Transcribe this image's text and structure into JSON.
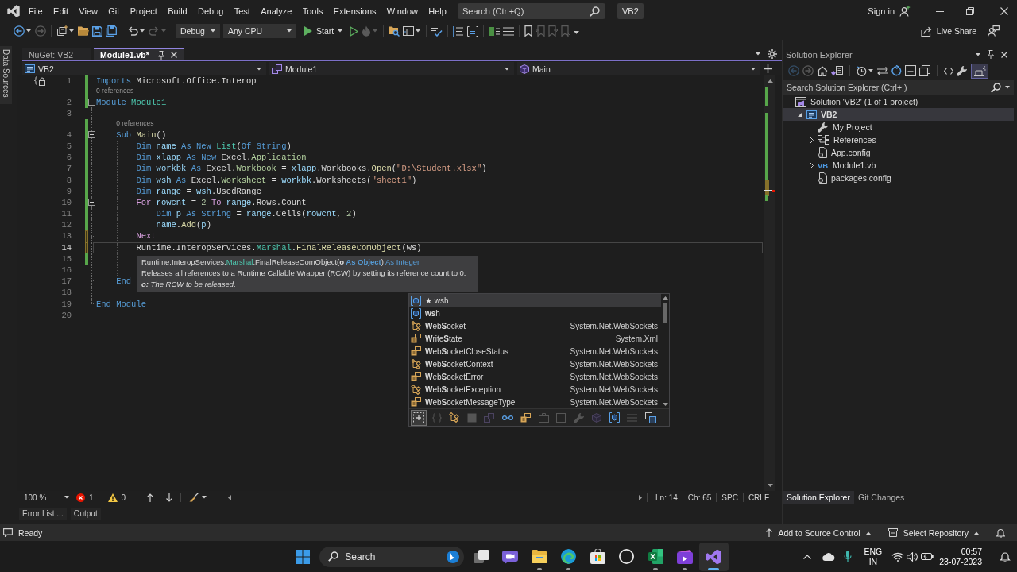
{
  "title_bar": {
    "menu": [
      "File",
      "Edit",
      "View",
      "Git",
      "Project",
      "Build",
      "Debug",
      "Test",
      "Analyze",
      "Tools",
      "Extensions",
      "Window",
      "Help"
    ],
    "search": {
      "placeholder": "Search (Ctrl+Q)"
    },
    "solution_name": "VB2",
    "sign_in": "Sign in"
  },
  "toolbar": {
    "items": [
      {
        "kind": "back",
        "disabled": false
      },
      {
        "kind": "caret",
        "disabled": false
      },
      {
        "kind": "forward",
        "disabled": true
      },
      {
        "kind": "separator"
      },
      {
        "kind": "new-item",
        "disabled": false
      },
      {
        "kind": "caret",
        "disabled": false
      },
      {
        "kind": "open",
        "disabled": false
      },
      {
        "kind": "save",
        "disabled": false
      },
      {
        "kind": "save-all",
        "disabled": false
      },
      {
        "kind": "separator"
      },
      {
        "kind": "undo",
        "disabled": false
      },
      {
        "kind": "caret",
        "disabled": false
      },
      {
        "kind": "redo",
        "disabled": true
      },
      {
        "kind": "caret",
        "disabled": true
      },
      {
        "kind": "separator"
      },
      {
        "kind": "configuration",
        "text": "Debug",
        "disabled": false
      },
      {
        "kind": "platform",
        "text": "Any CPU",
        "disabled": false
      },
      {
        "kind": "start",
        "text": "Start",
        "disabled": false
      },
      {
        "kind": "run",
        "disabled": false
      },
      {
        "kind": "hot-reload",
        "disabled": true
      },
      {
        "kind": "caret",
        "disabled": true
      },
      {
        "kind": "separator"
      },
      {
        "kind": "find-in-files",
        "disabled": false
      },
      {
        "kind": "layout",
        "disabled": false
      },
      {
        "kind": "caret",
        "disabled": false
      },
      {
        "kind": "separator"
      },
      {
        "kind": "spell-check",
        "disabled": false
      },
      {
        "kind": "separator"
      },
      {
        "kind": "step",
        "disabled": false
      },
      {
        "kind": "outline",
        "disabled": false
      },
      {
        "kind": "separator"
      },
      {
        "kind": "comment",
        "disabled": false
      },
      {
        "kind": "uncomment",
        "disabled": false
      },
      {
        "kind": "separator"
      },
      {
        "kind": "bookmark",
        "disabled": false
      },
      {
        "kind": "previous-bookmark",
        "disabled": true
      },
      {
        "kind": "next-bookmark",
        "disabled": true
      },
      {
        "kind": "clear-bookmarks",
        "disabled": true
      },
      {
        "kind": "overflow",
        "disabled": false
      }
    ],
    "live_share": "Live Share"
  },
  "side_panel": {
    "tabs": [
      "Data Sources"
    ]
  },
  "document_tabs": [
    {
      "label": "NuGet: VB2",
      "selected": false
    },
    {
      "label": "Module1.vb*",
      "selected": true
    }
  ],
  "navigation_bar": {
    "project": "VB2",
    "type": "Module1",
    "member": "Main"
  },
  "editor": {
    "lines": [
      {
        "number": "1",
        "tokens": [
          {
            "kind": "keyword",
            "text": "Imports"
          },
          {
            "kind": "plain",
            "text": " Microsoft.Office.Interop"
          }
        ],
        "changed": true,
        "saved": true,
        "quick_action": true
      },
      {
        "number": "2",
        "codelens": "0 references",
        "tokens": [
          {
            "kind": "keyword",
            "text": "Module"
          },
          {
            "kind": "type",
            "text": " Module1"
          }
        ],
        "changed": true,
        "saved": true,
        "expanded": true
      },
      {
        "number": "3"
      },
      {
        "number": "4",
        "codelens": "0 references",
        "tokens": [
          {
            "kind": "keyword",
            "text": "    Sub"
          },
          {
            "kind": "method",
            "text": " Main"
          },
          {
            "kind": "plain",
            "text": "()"
          }
        ],
        "changed": true,
        "saved": true,
        "expanded": true
      },
      {
        "number": "5",
        "tokens": [
          {
            "kind": "keyword",
            "text": "        Dim"
          },
          {
            "kind": "local",
            "text": " name"
          },
          {
            "kind": "keyword",
            "text": " As New"
          },
          {
            "kind": "type",
            "text": " List"
          },
          {
            "kind": "plain",
            "text": "("
          },
          {
            "kind": "keyword",
            "text": "Of String"
          },
          {
            "kind": "plain",
            "text": ")"
          }
        ],
        "changed": true,
        "saved": true
      },
      {
        "number": "6",
        "tokens": [
          {
            "kind": "keyword",
            "text": "        Dim"
          },
          {
            "kind": "local",
            "text": " xlapp"
          },
          {
            "kind": "keyword",
            "text": " As New"
          },
          {
            "kind": "plain",
            "text": " Excel."
          },
          {
            "kind": "interface",
            "text": "Application"
          }
        ],
        "changed": true,
        "saved": true
      },
      {
        "number": "7",
        "tokens": [
          {
            "kind": "keyword",
            "text": "        Dim"
          },
          {
            "kind": "local",
            "text": " workbk"
          },
          {
            "kind": "keyword",
            "text": " As"
          },
          {
            "kind": "plain",
            "text": " Excel."
          },
          {
            "kind": "interface",
            "text": "Workbook"
          },
          {
            "kind": "plain",
            "text": " = "
          },
          {
            "kind": "local",
            "text": "xlapp"
          },
          {
            "kind": "plain",
            "text": ".Workbooks."
          },
          {
            "kind": "method",
            "text": "Open"
          },
          {
            "kind": "plain",
            "text": "("
          },
          {
            "kind": "string",
            "text": "\"D:\\Student.xlsx\""
          },
          {
            "kind": "plain",
            "text": ")"
          }
        ],
        "changed": true,
        "saved": true
      },
      {
        "number": "8",
        "tokens": [
          {
            "kind": "keyword",
            "text": "        Dim"
          },
          {
            "kind": "local",
            "text": " wsh"
          },
          {
            "kind": "keyword",
            "text": " As"
          },
          {
            "kind": "plain",
            "text": " Excel."
          },
          {
            "kind": "interface",
            "text": "Worksheet"
          },
          {
            "kind": "plain",
            "text": " = "
          },
          {
            "kind": "local",
            "text": "workbk"
          },
          {
            "kind": "plain",
            "text": ".Worksheets("
          },
          {
            "kind": "string",
            "text": "\"sheet1\""
          },
          {
            "kind": "plain",
            "text": ")"
          }
        ],
        "changed": true,
        "saved": true
      },
      {
        "number": "9",
        "tokens": [
          {
            "kind": "keyword",
            "text": "        Dim"
          },
          {
            "kind": "local",
            "text": " range"
          },
          {
            "kind": "plain",
            "text": " = "
          },
          {
            "kind": "local",
            "text": "wsh"
          },
          {
            "kind": "plain",
            "text": ".UsedRange"
          }
        ],
        "changed": true,
        "saved": true
      },
      {
        "number": "10",
        "tokens": [
          {
            "kind": "control",
            "text": "        For"
          },
          {
            "kind": "local",
            "text": " rowcnt"
          },
          {
            "kind": "plain",
            "text": " = "
          },
          {
            "kind": "number",
            "text": "2"
          },
          {
            "kind": "control",
            "text": " To"
          },
          {
            "kind": "local",
            "text": " range"
          },
          {
            "kind": "plain",
            "text": ".Rows.Count"
          }
        ],
        "changed": true,
        "saved": true,
        "expanded": true
      },
      {
        "number": "11",
        "tokens": [
          {
            "kind": "keyword",
            "text": "            Dim"
          },
          {
            "kind": "local",
            "text": " p"
          },
          {
            "kind": "keyword",
            "text": " As String"
          },
          {
            "kind": "plain",
            "text": " = "
          },
          {
            "kind": "local",
            "text": "range"
          },
          {
            "kind": "plain",
            "text": ".Cells("
          },
          {
            "kind": "local",
            "text": "rowcnt"
          },
          {
            "kind": "plain",
            "text": ", "
          },
          {
            "kind": "number",
            "text": "2"
          },
          {
            "kind": "plain",
            "text": ")"
          }
        ],
        "changed": true,
        "saved": true
      },
      {
        "number": "12",
        "tokens": [
          {
            "kind": "local",
            "text": "            name"
          },
          {
            "kind": "plain",
            "text": "."
          },
          {
            "kind": "method",
            "text": "Add"
          },
          {
            "kind": "plain",
            "text": "("
          },
          {
            "kind": "local",
            "text": "p"
          },
          {
            "kind": "plain",
            "text": ")"
          }
        ],
        "changed": true,
        "saved": true
      },
      {
        "number": "13",
        "tokens": [
          {
            "kind": "control",
            "text": "        Next"
          }
        ],
        "changed": true,
        "saved": false
      },
      {
        "number": "14",
        "tokens": [
          {
            "kind": "plain",
            "text": "        Runtime.InteropServices."
          },
          {
            "kind": "type",
            "text": "Marshal"
          },
          {
            "kind": "plain",
            "text": "."
          },
          {
            "kind": "method",
            "text": "FinalReleaseComObject"
          },
          {
            "kind": "plain",
            "text": "(ws)"
          }
        ],
        "changed": true,
        "saved": false,
        "current": true
      },
      {
        "number": "15",
        "changed": true,
        "saved": true
      },
      {
        "number": "16"
      },
      {
        "number": "17",
        "tokens": [
          {
            "kind": "keyword",
            "text": "    End"
          }
        ]
      },
      {
        "number": "18"
      },
      {
        "number": "19",
        "tokens": [
          {
            "kind": "keyword",
            "text": "End Module"
          }
        ]
      },
      {
        "number": "20"
      }
    ],
    "quick_info": {
      "signature": [
        {
          "kind": "plain",
          "text": "Runtime.InteropServices."
        },
        {
          "kind": "type",
          "text": "Marshal"
        },
        {
          "kind": "plain",
          "text": ".FinalReleaseComObject("
        },
        {
          "kind": "param",
          "text": "o"
        },
        {
          "kind": "param_keyword",
          "text": " As Object"
        },
        {
          "kind": "plain",
          "text": ") "
        },
        {
          "kind": "keyword",
          "text": "As Integer"
        }
      ],
      "summary": "Releases all references to a Runtime Callable Wrapper (RCW) by setting its reference count to 0.",
      "parameter": "**o:** The RCW to be released."
    },
    "completion": {
      "items": [
        {
          "kind": "local",
          "label": "★ wsh",
          "selected": true
        },
        {
          "kind": "local",
          "label": "**ws**h",
          "selected": false
        },
        {
          "kind": "class",
          "label": "**W**eb**S**ocket",
          "namespace": "System.Net.WebSockets",
          "selected": false
        },
        {
          "kind": "enum",
          "label": "**W**rite**S**tate",
          "namespace": "System.Xml",
          "selected": false
        },
        {
          "kind": "enum",
          "label": "**W**eb**S**ocketCloseStatus",
          "namespace": "System.Net.WebSockets",
          "selected": false
        },
        {
          "kind": "class",
          "label": "**W**eb**S**ocketContext",
          "namespace": "System.Net.WebSockets",
          "selected": false
        },
        {
          "kind": "enum",
          "label": "**W**eb**S**ocketError",
          "namespace": "System.Net.WebSockets",
          "selected": false
        },
        {
          "kind": "class",
          "label": "**W**eb**S**ocketException",
          "namespace": "System.Net.WebSockets",
          "selected": false
        },
        {
          "kind": "enum",
          "label": "**W**eb**S**ocketMessageType",
          "namespace": "System.Net.WebSockets",
          "selected": false
        }
      ],
      "filters": [
        {
          "kind": "expander",
          "selected": true,
          "disabled": false
        },
        {
          "kind": "namespace",
          "selected": false,
          "disabled": true
        },
        {
          "kind": "class",
          "selected": false,
          "disabled": false
        },
        {
          "kind": "structure",
          "selected": false,
          "disabled": true
        },
        {
          "kind": "module",
          "selected": false,
          "disabled": true
        },
        {
          "kind": "interface",
          "selected": false,
          "disabled": false
        },
        {
          "kind": "enum",
          "selected": false,
          "disabled": false
        },
        {
          "kind": "delegate",
          "selected": false,
          "disabled": true
        },
        {
          "kind": "event",
          "selected": false,
          "disabled": true
        },
        {
          "kind": "property",
          "selected": false,
          "disabled": true
        },
        {
          "kind": "method",
          "selected": false,
          "disabled": true
        },
        {
          "kind": "local",
          "selected": false,
          "disabled": false
        },
        {
          "kind": "keyword",
          "selected": false,
          "disabled": true
        },
        {
          "kind": "snippet",
          "selected": false,
          "disabled": false
        }
      ]
    }
  },
  "editor_status": {
    "zoom": "100 %",
    "errors": "1",
    "warnings": "0",
    "line": "Ln: 14",
    "column": "Ch: 65",
    "whitespace": "SPC",
    "line_endings": "CRLF"
  },
  "tool_tabs": [
    "Error List ...",
    "Output"
  ],
  "solution_explorer": {
    "title": "Solution Explorer",
    "toolbar": [
      {
        "kind": "back",
        "disabled": true,
        "selected": false
      },
      {
        "kind": "forward",
        "disabled": true,
        "selected": false
      },
      {
        "kind": "home",
        "disabled": false,
        "selected": false
      },
      {
        "kind": "switch-views",
        "disabled": false,
        "selected": false
      },
      {
        "kind": "separator"
      },
      {
        "kind": "pending-changes",
        "disabled": false,
        "selected": false
      },
      {
        "kind": "caret",
        "disabled": false,
        "selected": false
      },
      {
        "kind": "sync",
        "disabled": false,
        "selected": false
      },
      {
        "kind": "refresh",
        "disabled": false,
        "selected": false
      },
      {
        "kind": "collapse-all",
        "disabled": false,
        "selected": false
      },
      {
        "kind": "show-all-files",
        "disabled": false,
        "selected": false
      },
      {
        "kind": "separator"
      },
      {
        "kind": "view-code",
        "disabled": false,
        "selected": false
      },
      {
        "kind": "properties",
        "disabled": false,
        "selected": false
      },
      {
        "kind": "preview",
        "disabled": false,
        "selected": true
      }
    ],
    "search": {
      "placeholder": "Search Solution Explorer (Ctrl+;)"
    },
    "tree": [
      {
        "label": "Solution 'VB2' (1 of 1 project)",
        "kind": "solution",
        "selected": false,
        "children": [
          {
            "label": "VB2",
            "kind": "project",
            "expanded": true,
            "selected": true,
            "children": [
              {
                "label": "My Project",
                "kind": "properties",
                "selected": false
              },
              {
                "label": "References",
                "kind": "references",
                "expanded": false,
                "selected": false
              },
              {
                "label": "App.config",
                "kind": "config",
                "selected": false
              },
              {
                "label": "Module1.vb",
                "kind": "vb-file",
                "icon_text": "VB",
                "expanded": false,
                "selected": false
              },
              {
                "label": "packages.config",
                "kind": "config",
                "selected": false
              }
            ]
          }
        ]
      }
    ],
    "tabs": [
      {
        "label": "Solution Explorer",
        "selected": true
      },
      {
        "label": "Git Changes",
        "selected": false
      }
    ]
  },
  "status_bar": {
    "message": "Ready",
    "source_control": "Add to Source Control",
    "repository": "Select Repository"
  },
  "taskbar": {
    "search": {
      "placeholder": "Search"
    },
    "apps": [
      {
        "kind": "task-view",
        "running": false,
        "selected": false
      },
      {
        "kind": "chat",
        "running": false,
        "selected": false
      },
      {
        "kind": "file-explorer",
        "running": true,
        "selected": false
      },
      {
        "kind": "browser",
        "running": true,
        "selected": false
      },
      {
        "kind": "store",
        "running": false,
        "selected": false
      },
      {
        "kind": "vendor",
        "running": false,
        "selected": false
      },
      {
        "kind": "spreadsheet",
        "running": true,
        "selected": false
      },
      {
        "kind": "video-editor",
        "running": true,
        "selected": false
      },
      {
        "kind": "visual-studio",
        "running": true,
        "selected": true
      }
    ],
    "language": "ENG",
    "region": "IN",
    "time": "00:57",
    "date": "23-07-2023"
  }
}
